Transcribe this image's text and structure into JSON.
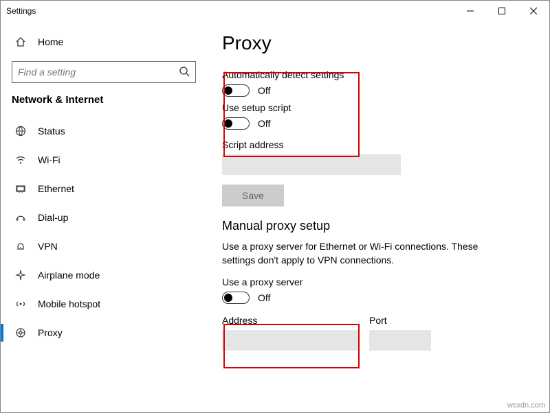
{
  "window": {
    "title": "Settings"
  },
  "sidebar": {
    "home": "Home",
    "search_placeholder": "Find a setting",
    "category": "Network & Internet",
    "items": [
      {
        "label": "Status"
      },
      {
        "label": "Wi-Fi"
      },
      {
        "label": "Ethernet"
      },
      {
        "label": "Dial-up"
      },
      {
        "label": "VPN"
      },
      {
        "label": "Airplane mode"
      },
      {
        "label": "Mobile hotspot"
      },
      {
        "label": "Proxy"
      }
    ]
  },
  "content": {
    "title": "Proxy",
    "auto": {
      "detect_label": "Automatically detect settings",
      "detect_state": "Off",
      "script_label": "Use setup script",
      "script_state": "Off",
      "address_label": "Script address",
      "save_label": "Save"
    },
    "manual": {
      "heading": "Manual proxy setup",
      "description": "Use a proxy server for Ethernet or Wi-Fi connections. These settings don't apply to VPN connections.",
      "use_proxy_label": "Use a proxy server",
      "use_proxy_state": "Off",
      "address_label": "Address",
      "port_label": "Port"
    }
  },
  "watermark": "wsxdn.com"
}
